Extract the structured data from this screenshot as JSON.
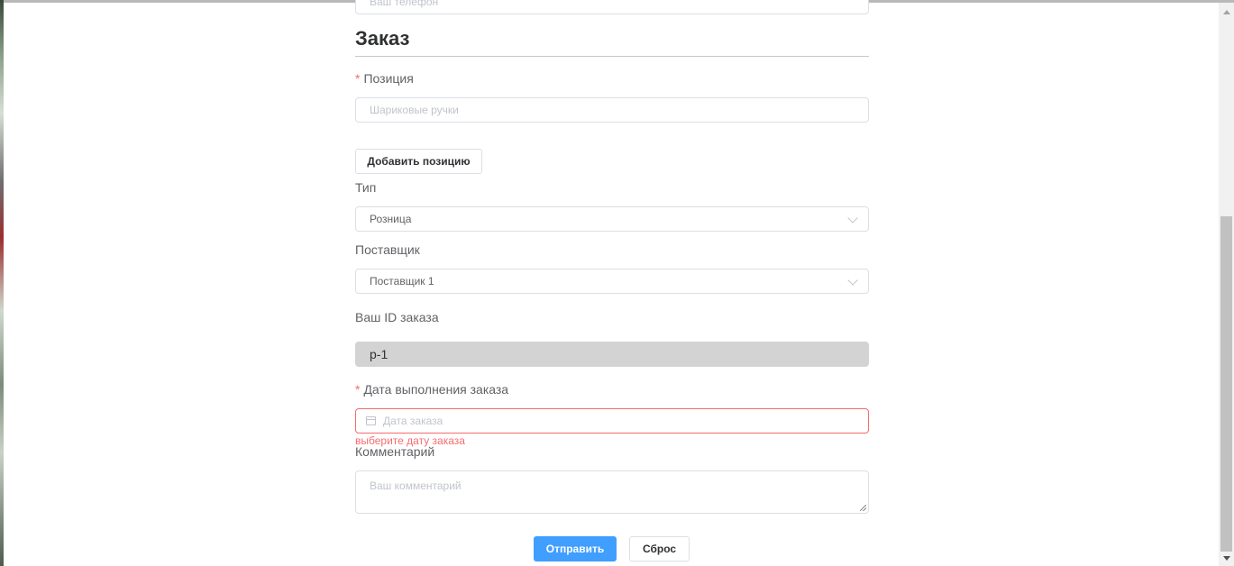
{
  "contact": {
    "phone_placeholder": "Ваш телефон"
  },
  "order": {
    "section_title": "Заказ",
    "required_mark": "*",
    "position_label": "Позиция",
    "position_placeholder": "Шариковые ручки",
    "add_position_button": "Добавить позицию",
    "type_label": "Тип",
    "type_selected": "Розница",
    "supplier_label": "Поставщик",
    "supplier_selected": "Поставщик 1",
    "order_id_label": "Ваш ID заказа",
    "order_id_value": "р-1",
    "date_label": "Дата выполнения заказа",
    "date_placeholder": "Дата заказа",
    "date_error": "выберите дату заказа",
    "comment_label": "Комментарий",
    "comment_placeholder": "Ваш комментарий"
  },
  "actions": {
    "submit_label": "Отправить",
    "reset_label": "Сброс"
  },
  "colors": {
    "primary": "#409eff",
    "error": "#f56c6c",
    "border": "#dcdfe6",
    "disabled_bg": "#d3d3d3"
  },
  "icons": {
    "select_arrow": "chevron-down-icon",
    "date_picker": "calendar-icon"
  }
}
